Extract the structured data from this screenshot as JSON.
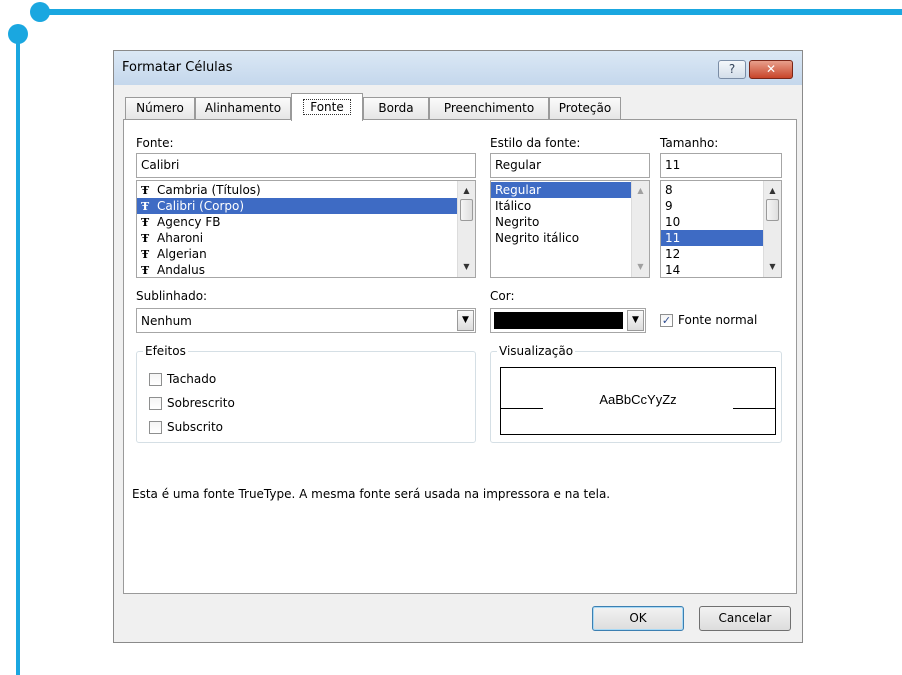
{
  "dialog": {
    "title": "Formatar Células",
    "help_label": "?",
    "close_label": "✕"
  },
  "tabs": [
    {
      "label": "Número"
    },
    {
      "label": "Alinhamento"
    },
    {
      "label": "Fonte"
    },
    {
      "label": "Borda"
    },
    {
      "label": "Preenchimento"
    },
    {
      "label": "Proteção"
    }
  ],
  "active_tab": "Fonte",
  "font": {
    "label": "Fonte:",
    "value": "Calibri",
    "items": [
      "Cambria (Títulos)",
      "Calibri (Corpo)",
      "Agency FB",
      "Aharoni",
      "Algerian",
      "Andalus"
    ],
    "selected": "Calibri (Corpo)",
    "item_icon": "truetype-icon"
  },
  "style": {
    "label": "Estilo da fonte:",
    "value": "Regular",
    "items": [
      "Regular",
      "Itálico",
      "Negrito",
      "Negrito itálico"
    ],
    "selected": "Regular"
  },
  "size": {
    "label": "Tamanho:",
    "value": "11",
    "items": [
      "8",
      "9",
      "10",
      "11",
      "12",
      "14"
    ],
    "selected": "11"
  },
  "underline": {
    "label": "Sublinhado:",
    "value": "Nenhum"
  },
  "color": {
    "label": "Cor:",
    "swatch": "#000000",
    "normal_font_label": "Fonte normal",
    "normal_font_checked": true
  },
  "effects": {
    "title": "Efeitos",
    "items": [
      {
        "label": "Tachado",
        "checked": false
      },
      {
        "label": "Sobrescrito",
        "checked": false
      },
      {
        "label": "Subscrito",
        "checked": false
      }
    ]
  },
  "preview": {
    "title": "Visualização",
    "sample": "AaBbCcYyZz"
  },
  "info_text": "Esta é uma fonte TrueType. A mesma fonte será usada na impressora e na tela.",
  "buttons": {
    "ok": "OK",
    "cancel": "Cancelar"
  },
  "colors": {
    "accent": "#1aa7e0",
    "selection": "#3e6bc4"
  }
}
